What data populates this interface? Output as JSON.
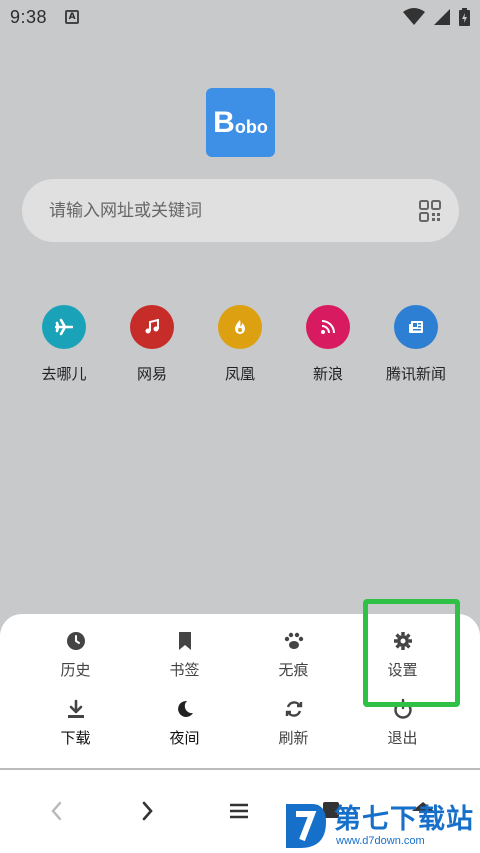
{
  "status_bar": {
    "time": "9:38",
    "app_icon_letter": "A"
  },
  "logo": {
    "text_big": "B",
    "text_small": "obo"
  },
  "search": {
    "placeholder": "请输入网址或关键词"
  },
  "shortcuts": [
    {
      "label": "去哪儿",
      "color": "#1aa3b8",
      "icon": "plane-icon"
    },
    {
      "label": "网易",
      "color": "#c62d28",
      "icon": "music-note-icon"
    },
    {
      "label": "凤凰",
      "color": "#dca010",
      "icon": "flame-icon"
    },
    {
      "label": "新浪",
      "color": "#d81b60",
      "icon": "rss-icon"
    },
    {
      "label": "腾讯新闻",
      "color": "#2d7fd3",
      "icon": "newspaper-icon"
    }
  ],
  "menu": {
    "history": "历史",
    "bookmarks": "书签",
    "incognito": "无痕",
    "settings": "设置",
    "downloads": "下载",
    "night": "夜间",
    "refresh": "刷新",
    "exit": "退出"
  },
  "watermark": {
    "title": "第七下载站",
    "sub": "www.d7down.com"
  },
  "colors": {
    "highlight": "#2ec145",
    "icon": "#444444",
    "background": "#c8c9cb"
  }
}
